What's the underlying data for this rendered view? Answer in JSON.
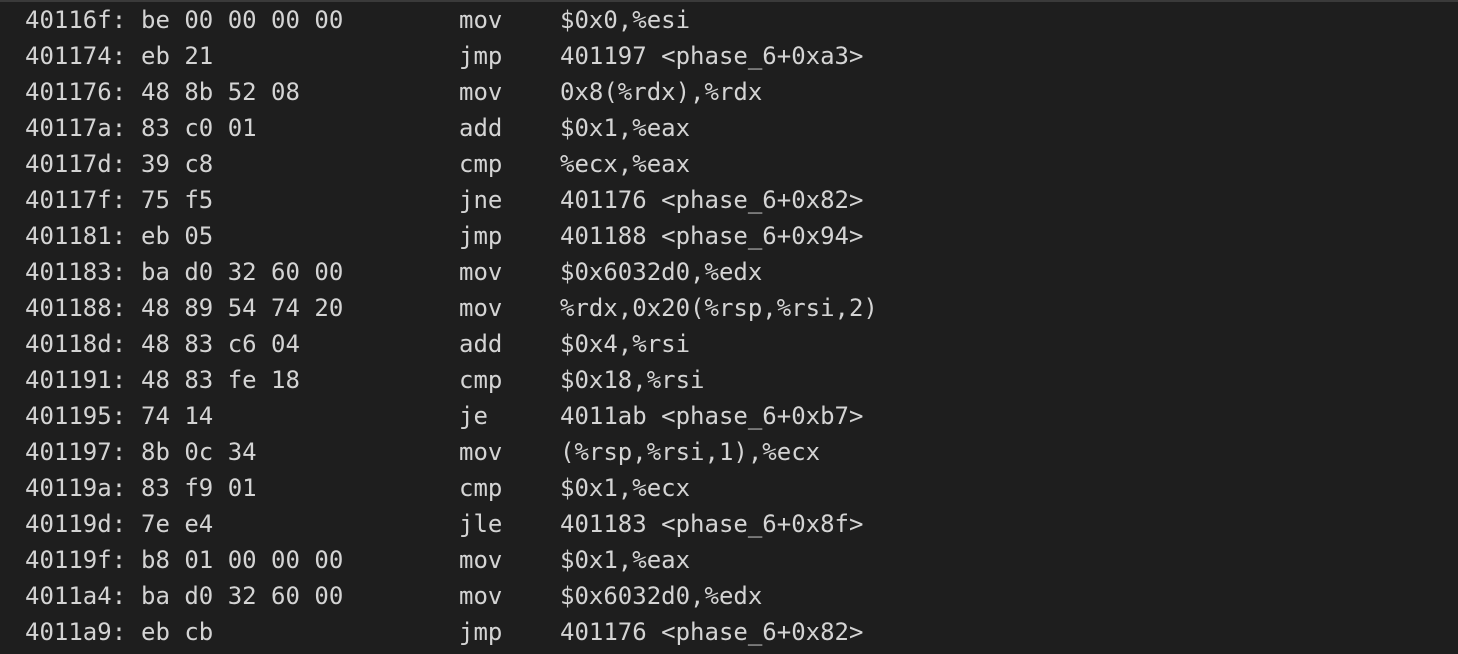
{
  "disassembly": {
    "rows": [
      {
        "addr": "40116f:",
        "bytes": "be 00 00 00 00",
        "mnemonic": "mov",
        "operands": "$0x0,%esi"
      },
      {
        "addr": "401174:",
        "bytes": "eb 21",
        "mnemonic": "jmp",
        "operands": "401197 <phase_6+0xa3>"
      },
      {
        "addr": "401176:",
        "bytes": "48 8b 52 08",
        "mnemonic": "mov",
        "operands": "0x8(%rdx),%rdx"
      },
      {
        "addr": "40117a:",
        "bytes": "83 c0 01",
        "mnemonic": "add",
        "operands": "$0x1,%eax"
      },
      {
        "addr": "40117d:",
        "bytes": "39 c8",
        "mnemonic": "cmp",
        "operands": "%ecx,%eax"
      },
      {
        "addr": "40117f:",
        "bytes": "75 f5",
        "mnemonic": "jne",
        "operands": "401176 <phase_6+0x82>"
      },
      {
        "addr": "401181:",
        "bytes": "eb 05",
        "mnemonic": "jmp",
        "operands": "401188 <phase_6+0x94>"
      },
      {
        "addr": "401183:",
        "bytes": "ba d0 32 60 00",
        "mnemonic": "mov",
        "operands": "$0x6032d0,%edx"
      },
      {
        "addr": "401188:",
        "bytes": "48 89 54 74 20",
        "mnemonic": "mov",
        "operands": "%rdx,0x20(%rsp,%rsi,2)"
      },
      {
        "addr": "40118d:",
        "bytes": "48 83 c6 04",
        "mnemonic": "add",
        "operands": "$0x4,%rsi"
      },
      {
        "addr": "401191:",
        "bytes": "48 83 fe 18",
        "mnemonic": "cmp",
        "operands": "$0x18,%rsi"
      },
      {
        "addr": "401195:",
        "bytes": "74 14",
        "mnemonic": "je",
        "operands": "4011ab <phase_6+0xb7>"
      },
      {
        "addr": "401197:",
        "bytes": "8b 0c 34",
        "mnemonic": "mov",
        "operands": "(%rsp,%rsi,1),%ecx"
      },
      {
        "addr": "40119a:",
        "bytes": "83 f9 01",
        "mnemonic": "cmp",
        "operands": "$0x1,%ecx"
      },
      {
        "addr": "40119d:",
        "bytes": "7e e4",
        "mnemonic": "jle",
        "operands": "401183 <phase_6+0x8f>"
      },
      {
        "addr": "40119f:",
        "bytes": "b8 01 00 00 00",
        "mnemonic": "mov",
        "operands": "$0x1,%eax"
      },
      {
        "addr": "4011a4:",
        "bytes": "ba d0 32 60 00",
        "mnemonic": "mov",
        "operands": "$0x6032d0,%edx"
      },
      {
        "addr": "4011a9:",
        "bytes": "eb cb",
        "mnemonic": "jmp",
        "operands": "401176 <phase_6+0x82>"
      }
    ]
  },
  "theme": {
    "background": "#1e1e1e",
    "text": "#d4d4d4"
  }
}
